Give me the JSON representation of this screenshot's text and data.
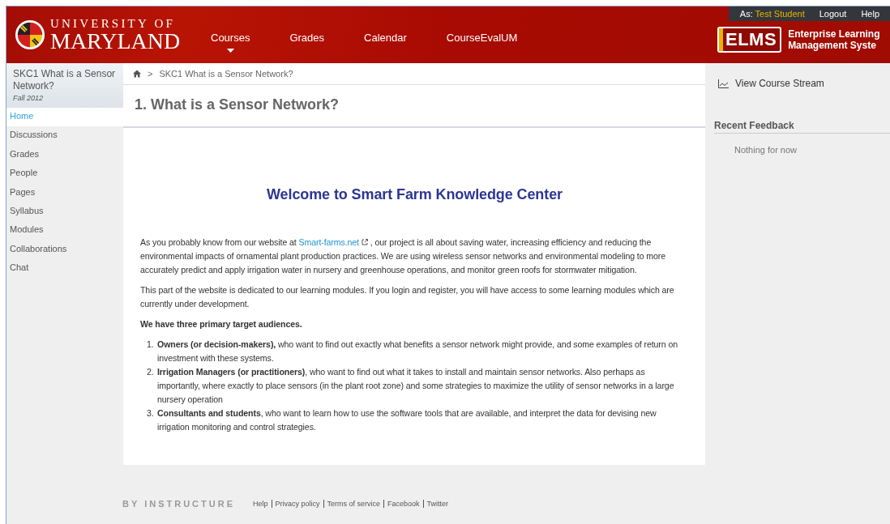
{
  "header": {
    "university_line1": "UNIVERSITY OF",
    "university_line2": "MARYLAND",
    "nav": [
      {
        "label": "Courses",
        "dropdown": true
      },
      {
        "label": "Grades",
        "dropdown": false
      },
      {
        "label": "Calendar",
        "dropdown": false
      },
      {
        "label": "CourseEvalUM",
        "dropdown": false
      }
    ],
    "user_prefix": "As:",
    "user_name": "Test Student",
    "logout": "Logout",
    "help": "Help",
    "elms_logo": "ELMS",
    "elms_line1": "Enterprise Learning",
    "elms_line2": "Management Syste"
  },
  "sidebar": {
    "course_title": "SKC1 What is a Sensor Network?",
    "term": "Fall 2012",
    "items": [
      {
        "label": "Home",
        "selected": true
      },
      {
        "label": "Discussions",
        "selected": false
      },
      {
        "label": "Grades",
        "selected": false
      },
      {
        "label": "People",
        "selected": false
      },
      {
        "label": "Pages",
        "selected": false
      },
      {
        "label": "Syllabus",
        "selected": false
      },
      {
        "label": "Modules",
        "selected": false
      },
      {
        "label": "Collaborations",
        "selected": false
      },
      {
        "label": "Chat",
        "selected": false
      }
    ]
  },
  "breadcrumb": [
    {
      "separator": ">",
      "label": "SKC1 What is a Sensor Network?"
    }
  ],
  "page_title": "1. What is a Sensor Network?",
  "content": {
    "heading": "Welcome to Smart Farm Knowledge Center",
    "intro_before": "As you probably know from our website at ",
    "intro_link": "Smart-farms.net",
    "intro_after": " , our project is all about saving water, increasing efficiency and reducing the environmental impacts of ornamental plant production practices. We are using wireless sensor networks and environmental modeling to more accurately predict and apply irrigation water in nursery and greenhouse operations, and monitor green roofs for stormwater mitigation.",
    "paragraph2": "This part of the website is dedicated to our learning modules. If you login and register, you will have access to some learning modules which are currently under development.",
    "audiences_heading": "We have three primary target audiences.",
    "audiences": [
      {
        "number": "1.",
        "text": "**Owners (or decision-makers),** who want to find out exactly what benefits a sensor network might provide, and some examples of return on investment with these systems."
      },
      {
        "number": "2.",
        "text": "**Irrigation Managers (or practitioners)**, who want to find out what it takes to install and maintain sensor networks. Also perhaps as importantly, where exactly to place sensors (in the plant root zone) and some strategies to maximize the utility of sensor networks in a large nursery operation"
      },
      {
        "number": "3.",
        "text": "**Consultants and students**, who want to learn how to use the software tools that are available, and interpret the data for devising new irrigation monitoring and control strategies."
      }
    ]
  },
  "right_panel": {
    "stream_link": "View Course Stream",
    "feedback_heading": "Recent Feedback",
    "feedback_empty": "Nothing for now"
  },
  "footer": {
    "brand": "BY INSTRUCTURE",
    "links": [
      "Help",
      "Privacy policy",
      "Terms of service",
      "Facebook",
      "Twitter"
    ]
  }
}
